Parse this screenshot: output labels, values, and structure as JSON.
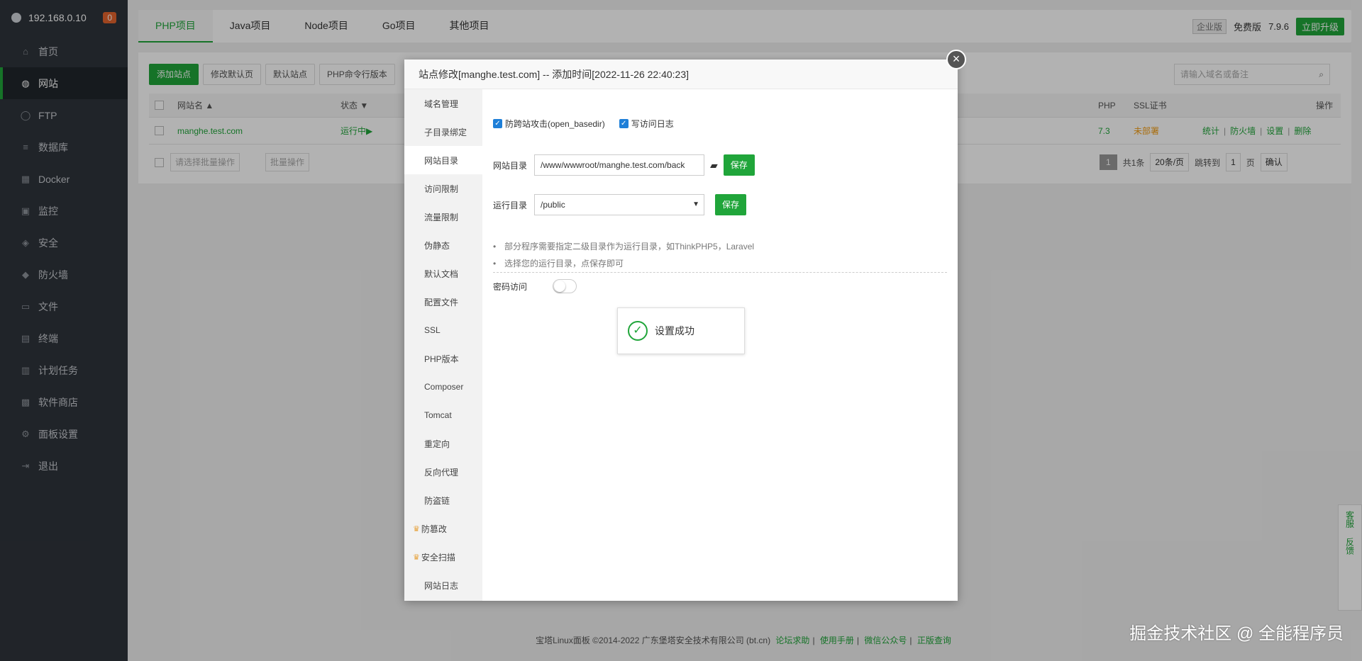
{
  "sidebar": {
    "server": "192.168.0.10",
    "badge": "0",
    "items": [
      {
        "label": "首页",
        "icon": "home-icon"
      },
      {
        "label": "网站",
        "icon": "globe-icon"
      },
      {
        "label": "FTP",
        "icon": "ftp-icon"
      },
      {
        "label": "数据库",
        "icon": "database-icon"
      },
      {
        "label": "Docker",
        "icon": "docker-icon"
      },
      {
        "label": "监控",
        "icon": "monitor-icon"
      },
      {
        "label": "安全",
        "icon": "shield-icon"
      },
      {
        "label": "防火墙",
        "icon": "firewall-icon"
      },
      {
        "label": "文件",
        "icon": "folder-icon"
      },
      {
        "label": "终端",
        "icon": "terminal-icon"
      },
      {
        "label": "计划任务",
        "icon": "calendar-icon"
      },
      {
        "label": "软件商店",
        "icon": "grid-icon"
      },
      {
        "label": "面板设置",
        "icon": "gear-icon"
      },
      {
        "label": "退出",
        "icon": "logout-icon"
      }
    ]
  },
  "tabs": [
    "PHP项目",
    "Java项目",
    "Node项目",
    "Go项目",
    "其他项目"
  ],
  "top_right": {
    "edition": "企业版",
    "free": "免费版",
    "version": "7.9.6",
    "upgrade": "立即升级"
  },
  "toolbar": [
    "添加站点",
    "修改默认页",
    "默认站点",
    "PHP命令行版本"
  ],
  "search_placeholder": "请输入域名或备注",
  "table": {
    "headers": {
      "name": "网站名 ▲",
      "status": "状态 ▼",
      "php": "PHP",
      "ssl": "SSL证书",
      "ops": "操作"
    },
    "row": {
      "name": "manghe.test.com",
      "status": "运行中▶",
      "php": "7.3",
      "ssl": "未部署",
      "ops": [
        "统计",
        "防火墙",
        "设置",
        "删除"
      ]
    }
  },
  "batch": {
    "select": "请选择批量操作",
    "button": "批量操作"
  },
  "pagination": {
    "page": "1",
    "total": "共1条",
    "per_page": "20条/页",
    "jump": "跳转到",
    "jump_value": "1",
    "page_unit": "页",
    "confirm": "确认"
  },
  "footer": {
    "copyright": "宝塔Linux面板 ©2014-2022 广东堡塔安全技术有限公司 (bt.cn)",
    "links": [
      "论坛求助",
      "使用手册",
      "微信公众号",
      "正版查询"
    ]
  },
  "watermark": "掘金技术社区 @ 全能程序员",
  "service": {
    "kefu": "客服",
    "feedback": "反馈"
  },
  "modal": {
    "title": "站点修改[manghe.test.com] -- 添加时间[2022-11-26 22:40:23]",
    "nav": [
      "域名管理",
      "子目录绑定",
      "网站目录",
      "访问限制",
      "流量限制",
      "伪静态",
      "默认文档",
      "配置文件",
      "SSL",
      "PHP版本",
      "Composer",
      "Tomcat",
      "重定向",
      "反向代理",
      "防盗链",
      "防篡改",
      "安全扫描",
      "网站日志"
    ],
    "checkbox1": "防跨站攻击(open_basedir)",
    "checkbox2": "写访问日志",
    "dir_label": "网站目录",
    "dir_value": "/www/wwwroot/manghe.test.com/back",
    "run_label": "运行目录",
    "run_value": "/public",
    "save": "保存",
    "tips": [
      "部分程序需要指定二级目录作为运行目录，如ThinkPHP5，Laravel",
      "选择您的运行目录，点保存即可"
    ],
    "pwd_label": "密码访问",
    "toast": "设置成功"
  }
}
